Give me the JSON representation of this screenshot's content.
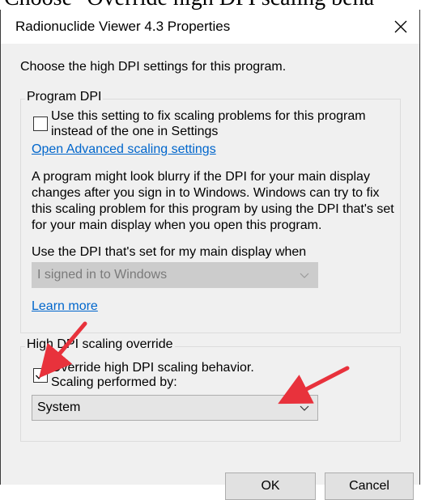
{
  "page_heading": "Choose \"Override high DPI scaling beha",
  "window": {
    "title": "Radionuclide Viewer 4.3 Properties",
    "close_glyph": "×"
  },
  "intro": "Choose the high DPI settings for this program.",
  "program_dpi": {
    "legend": "Program DPI",
    "checkbox_line1": "Use this setting to fix scaling problems for this program",
    "checkbox_line2": "instead of the one in Settings",
    "checkbox_checked": false,
    "advanced_link": "Open Advanced scaling settings",
    "description": [
      "A program might look blurry if the DPI for your main display",
      "changes after you sign in to Windows. Windows can try to fix",
      "this scaling problem for this program by using the DPI that's set",
      "for your main display when you open this program."
    ],
    "dpi_label": "Use the DPI that's set for my main display when",
    "dpi_select_value": "I signed in to Windows",
    "learn_more": "Learn more"
  },
  "override": {
    "legend": "High DPI scaling override",
    "checkbox_line1": "Override high DPI scaling behavior.",
    "checkbox_line2": "Scaling performed by:",
    "checkbox_checked": true,
    "select_value": "System"
  },
  "buttons": {
    "ok": "OK",
    "cancel": "Cancel"
  },
  "colors": {
    "link": "#0066cc",
    "annotation_arrow": "#e8323c",
    "dialog_bg": "#f0f0f0"
  }
}
